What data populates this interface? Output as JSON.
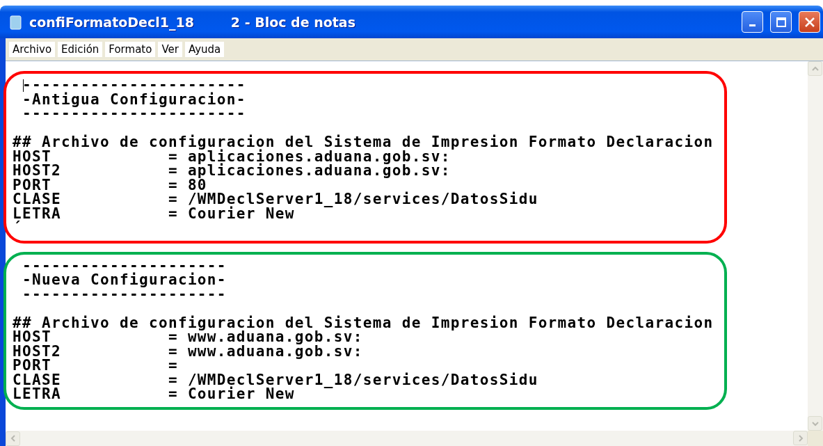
{
  "window": {
    "title": "confiFormatoDecl1_18        2 - Bloc de notas"
  },
  "menu": [
    "Archivo",
    "Edición",
    "Formato",
    "Ver",
    "Ayuda"
  ],
  "sections": [
    {
      "color": "#ff0000",
      "caret": true,
      "header": [
        " -----------------------",
        " -Antigua Configuracion-",
        " -----------------------"
      ],
      "body": [
        "## Archivo de configuracion del Sistema de Impresion Formato Declaracion",
        "HOST            = aplicaciones.aduana.gob.sv:",
        "HOST2           = aplicaciones.aduana.gob.sv:",
        "PORT            = 80",
        "CLASE           = /WMDeclServer1_18/services/DatosSidu",
        "LETRA           = Courier New",
        "´"
      ]
    },
    {
      "color": "#00b050",
      "caret": false,
      "header": [
        " ---------------------",
        " -Nueva Configuracion-",
        " ---------------------"
      ],
      "body": [
        "## Archivo de configuracion del Sistema de Impresion Formato Declaracion",
        "HOST            = www.aduana.gob.sv:",
        "HOST2           = www.aduana.gob.sv:",
        "PORT            =",
        "CLASE           = /WMDeclServer1_18/services/DatosSidu",
        "LETRA           = Courier New"
      ]
    }
  ]
}
